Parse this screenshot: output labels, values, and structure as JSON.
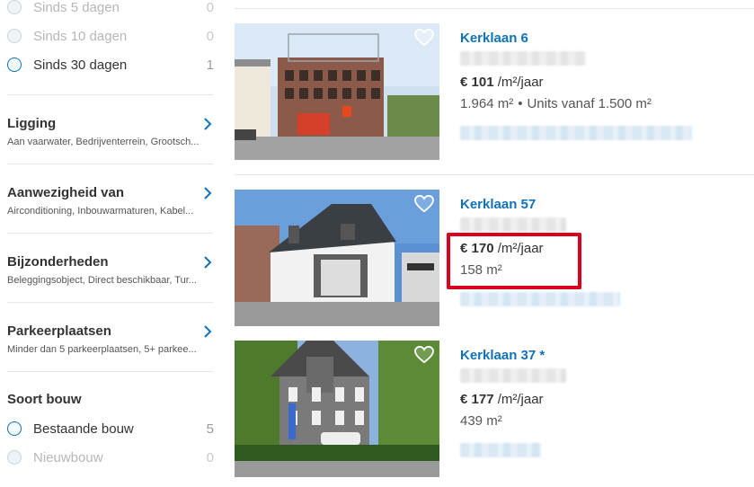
{
  "sidebar": {
    "age_filters": [
      {
        "label": "Sinds 5 dagen",
        "count": "0"
      },
      {
        "label": "Sinds 10 dagen",
        "count": "0"
      },
      {
        "label": "Sinds 30 dagen",
        "count": "1"
      }
    ],
    "filters": [
      {
        "title": "Ligging",
        "subtitle": "Aan vaarwater, Bedrijventerrein, Grootsch..."
      },
      {
        "title": "Aanwezigheid van",
        "subtitle": "Airconditioning, Inbouwarmaturen, Kabel..."
      },
      {
        "title": "Bijzonderheden",
        "subtitle": "Beleggingsobject, Direct beschikbaar, Tur..."
      },
      {
        "title": "Parkeerplaatsen",
        "subtitle": "Minder dan 5 parkeerplaatsen, 5+ parkee..."
      }
    ],
    "build_type": {
      "title": "Soort bouw",
      "options": [
        {
          "label": "Bestaande bouw",
          "count": "5"
        },
        {
          "label": "Nieuwbouw",
          "count": "0"
        }
      ]
    }
  },
  "listings": [
    {
      "title": "Kerklaan 6",
      "price": "€ 101",
      "price_unit": " /m²/jaar",
      "area": "1.964 m²",
      "extra": "Units vanaf 1.500 m²"
    },
    {
      "title": "Kerklaan 57",
      "price": "€ 170",
      "price_unit": " /m²/jaar",
      "area": "158 m²",
      "extra": ""
    },
    {
      "title": "Kerklaan 37 *",
      "price": "€ 177",
      "price_unit": " /m²/jaar",
      "area": "439 m²",
      "extra": ""
    }
  ],
  "colors": {
    "accent": "#0f72b8",
    "highlight": "#d9001b"
  }
}
